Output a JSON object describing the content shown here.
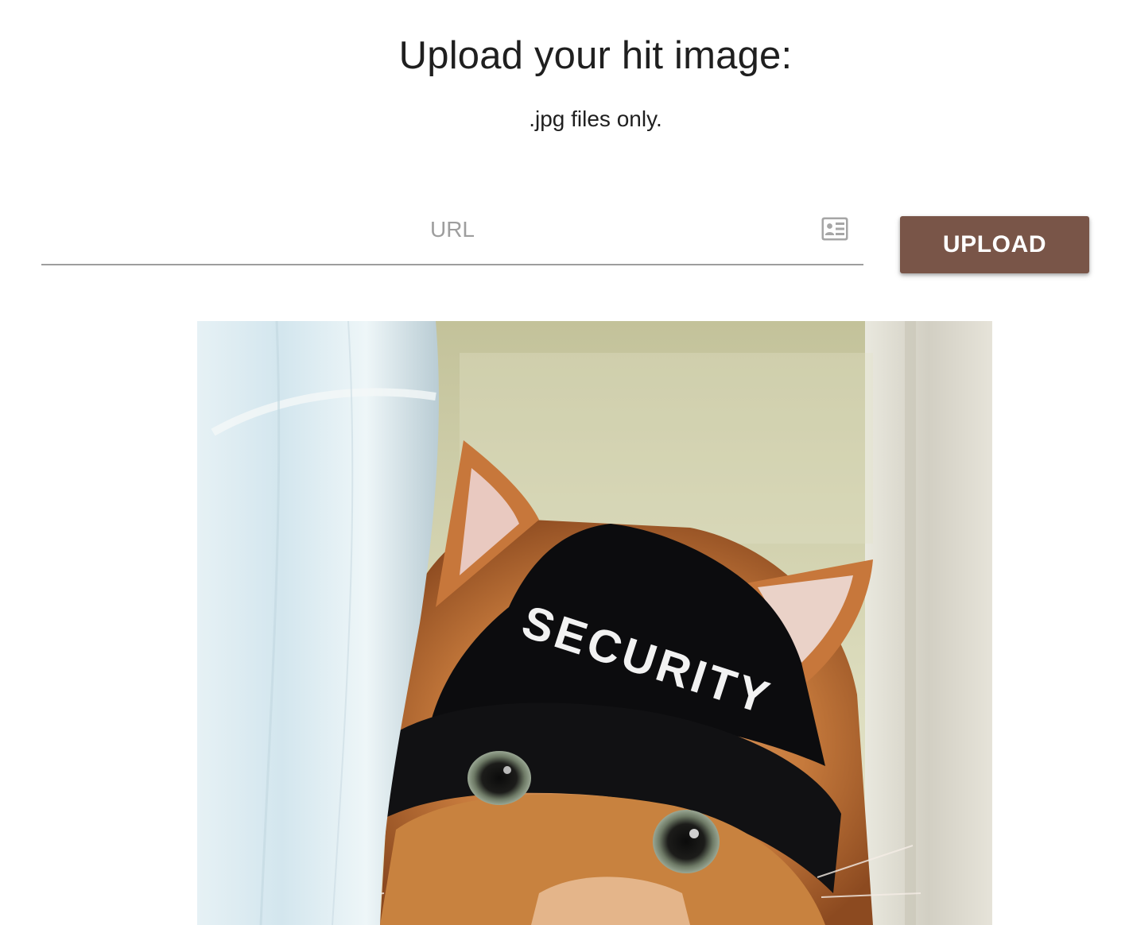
{
  "header": {
    "title": "Upload your hit image:",
    "subtitle": ".jpg files only."
  },
  "form": {
    "url_placeholder": "URL",
    "url_value": "",
    "url_icon": "contact-card-icon",
    "upload_label": "UPLOAD"
  },
  "image": {
    "hat_text": "SECURITY"
  },
  "colors": {
    "button_bg": "#795548",
    "button_text": "#ffffff",
    "placeholder": "#9e9e9e"
  }
}
